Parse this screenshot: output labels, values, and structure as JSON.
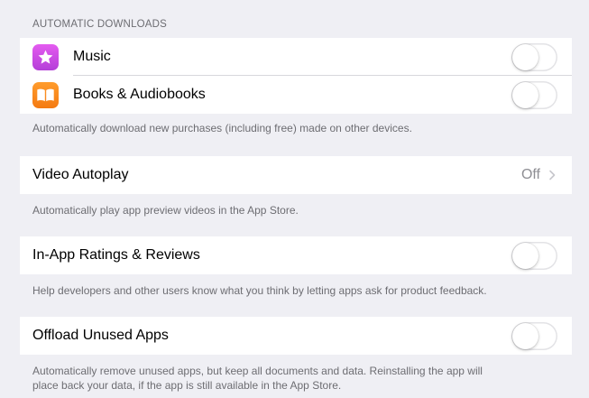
{
  "automatic_downloads": {
    "header": "AUTOMATIC DOWNLOADS",
    "items": [
      {
        "label": "Music",
        "icon": "music-star-icon",
        "icon_color": "#c94be6",
        "enabled": false
      },
      {
        "label": "Books & Audiobooks",
        "icon": "open-book-icon",
        "icon_color": "#f7891b",
        "enabled": false
      }
    ],
    "footer": "Automatically download new purchases (including free) made on other devices."
  },
  "video_autoplay": {
    "label": "Video Autoplay",
    "value": "Off",
    "footer": "Automatically play app preview videos in the App Store."
  },
  "ratings_reviews": {
    "label": "In-App Ratings & Reviews",
    "enabled": false,
    "footer": "Help developers and other users know what you think by letting apps ask for product feedback."
  },
  "offload": {
    "label": "Offload Unused Apps",
    "enabled": false,
    "footer_line1": "Automatically remove unused apps, but keep all documents and data. Reinstalling the app will",
    "footer_line2": "place back your data, if the app is still available in the App Store."
  },
  "colors": {
    "background": "#efeff4",
    "footer_text": "#6d6d72",
    "secondary_value": "#8e8e93"
  }
}
